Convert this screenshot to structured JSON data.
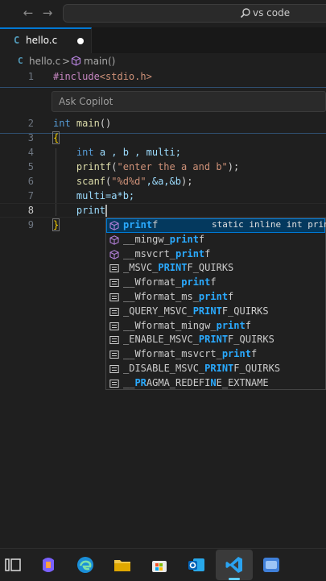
{
  "titlebar": {
    "search_text": "vs code",
    "back_icon": "arrow-left-icon",
    "forward_icon": "arrow-right-icon"
  },
  "tab": {
    "icon_letter": "C",
    "label": "hello.c"
  },
  "breadcrumb": {
    "icon_letter": "C",
    "file": "hello.c",
    "separator": ">",
    "symbol": "main()"
  },
  "copilot": {
    "placeholder": "Ask Copilot"
  },
  "editor": {
    "line_numbers": [
      "1",
      "2",
      "3",
      "4",
      "5",
      "6",
      "7",
      "8",
      "9"
    ],
    "line1": {
      "directive": "#include",
      "header": "<stdio.h>"
    },
    "line2": {
      "type": "int",
      "name": "main",
      "parens": "()"
    },
    "line3": {
      "brace": "{"
    },
    "line4": {
      "type": "int",
      "rest": "a , b , multi;"
    },
    "line5": {
      "fn": "printf",
      "open": "(",
      "str": "\"enter the a and b\"",
      "close": ");"
    },
    "line6": {
      "fn": "scanf",
      "open": "(",
      "str": "\"%d%d\"",
      "args": ",&a,&b",
      "close": ");"
    },
    "line7": {
      "text": "multi=a*b;"
    },
    "line8": {
      "text": "print"
    },
    "line9": {
      "brace": "}"
    }
  },
  "suggestions": [
    {
      "icon": "cube-icon",
      "pre": "",
      "match": "print",
      "post": "f",
      "detail": "static inline int print"
    },
    {
      "icon": "cube-icon",
      "pre": "__mingw_",
      "match": "print",
      "post": "f",
      "detail": ""
    },
    {
      "icon": "cube-icon",
      "pre": "__msvcrt_",
      "match": "print",
      "post": "f",
      "detail": ""
    },
    {
      "icon": "text-icon",
      "pre": "_MSVC_",
      "match": "PRINT",
      "post": "F_QUIRKS",
      "detail": ""
    },
    {
      "icon": "text-icon",
      "pre": "__Wformat_",
      "match": "print",
      "post": "f",
      "detail": ""
    },
    {
      "icon": "text-icon",
      "pre": "__Wformat_ms_",
      "match": "print",
      "post": "f",
      "detail": ""
    },
    {
      "icon": "text-icon",
      "pre": "_QUERY_MSVC_",
      "match": "PRINT",
      "post": "F_QUIRKS",
      "detail": ""
    },
    {
      "icon": "text-icon",
      "pre": "__Wformat_mingw_",
      "match": "print",
      "post": "f",
      "detail": ""
    },
    {
      "icon": "text-icon",
      "pre": "_ENABLE_MSVC_",
      "match": "PRINT",
      "post": "F_QUIRKS",
      "detail": ""
    },
    {
      "icon": "text-icon",
      "pre": "__Wformat_msvcrt_",
      "match": "print",
      "post": "f",
      "detail": ""
    },
    {
      "icon": "text-icon",
      "pre": "_DISABLE_MSVC_",
      "match": "PRINT",
      "post": "F_QUIRKS",
      "detail": ""
    },
    {
      "icon": "text-icon",
      "pre": "__",
      "match": "PR",
      "post": "AGMA_REDEFI",
      "match2": "N",
      "post2": "E_EXTNAME",
      "detail": ""
    }
  ],
  "taskbar": {
    "icons": [
      "task-view-icon",
      "copilot-icon",
      "edge-icon",
      "file-explorer-icon",
      "store-icon",
      "outlook-icon",
      "vscode-icon",
      "app-icon"
    ]
  },
  "colors": {
    "accent": "#0078d4",
    "keyword": "#569cd6",
    "string": "#ce9178",
    "function": "#dcdcaa",
    "match": "#2aaaff"
  }
}
